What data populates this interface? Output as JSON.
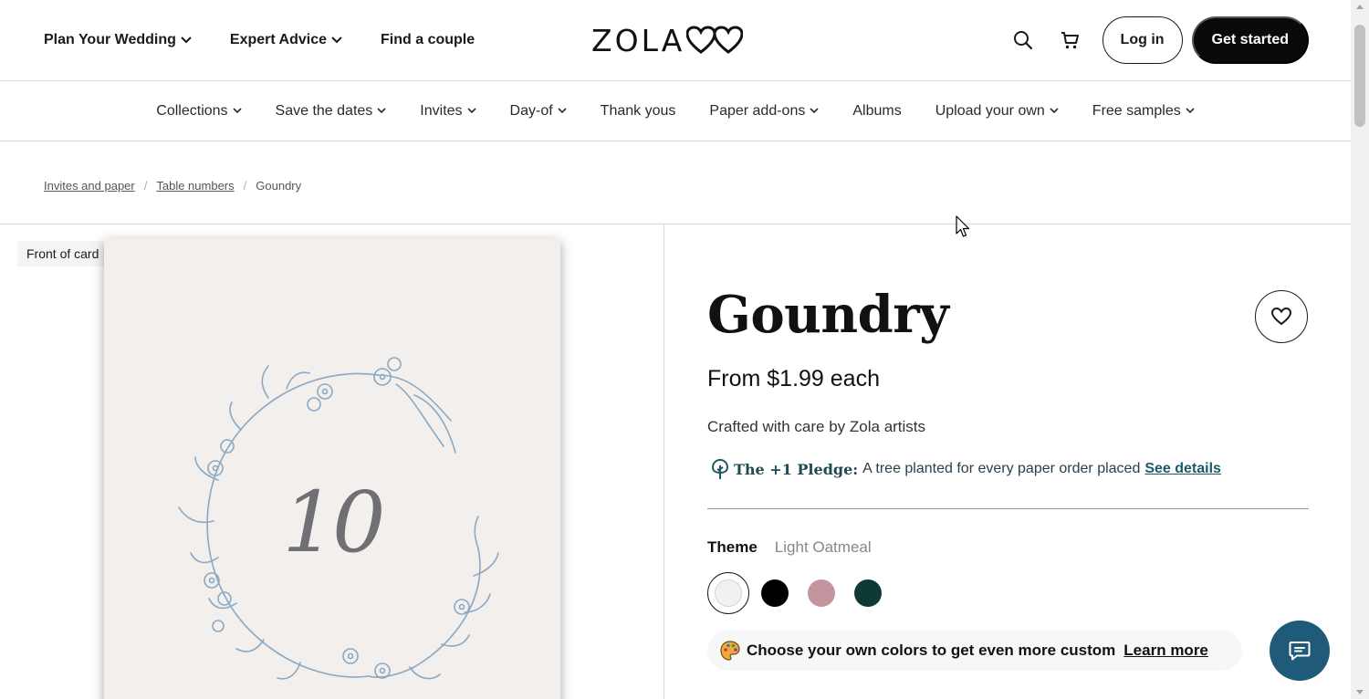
{
  "header": {
    "primary_nav": [
      {
        "label": "Plan Your Wedding",
        "has_dropdown": true
      },
      {
        "label": "Expert Advice",
        "has_dropdown": true
      },
      {
        "label": "Find a couple",
        "has_dropdown": false
      }
    ],
    "logo_text": "ZOLA",
    "login_label": "Log in",
    "get_started_label": "Get started",
    "icons": [
      "search-icon",
      "cart-icon",
      "double-heart-logo-icon"
    ]
  },
  "secondary_nav": [
    {
      "label": "Collections",
      "has_dropdown": true
    },
    {
      "label": "Save the dates",
      "has_dropdown": true
    },
    {
      "label": "Invites",
      "has_dropdown": true
    },
    {
      "label": "Day-of",
      "has_dropdown": true
    },
    {
      "label": "Thank yous",
      "has_dropdown": false
    },
    {
      "label": "Paper add-ons",
      "has_dropdown": true
    },
    {
      "label": "Albums",
      "has_dropdown": false
    },
    {
      "label": "Upload your own",
      "has_dropdown": true
    },
    {
      "label": "Free samples",
      "has_dropdown": true
    }
  ],
  "breadcrumb": {
    "items": [
      "Invites and paper",
      "Table numbers"
    ],
    "current": "Goundry"
  },
  "preview": {
    "label": "Front of card",
    "card_number": "10",
    "card_background": "#f3efec",
    "wreath_color": "#8aa9c4"
  },
  "product": {
    "title": "Goundry",
    "price": "From $1.99 each",
    "crafted": "Crafted with care by Zola artists",
    "pledge_title": "The +1 Pledge:",
    "pledge_text": "A tree planted for every paper order placed",
    "pledge_link": "See details",
    "theme_label": "Theme",
    "theme_value": "Light Oatmeal",
    "swatches": [
      {
        "name": "Light Oatmeal",
        "color": "#f3f1ef",
        "selected": true
      },
      {
        "name": "Black",
        "color": "#000000",
        "selected": false
      },
      {
        "name": "Mauve",
        "color": "#c3959f",
        "selected": false
      },
      {
        "name": "Forest",
        "color": "#0e3a36",
        "selected": false
      }
    ],
    "custom_text": "Choose your own colors to get even more custom",
    "custom_link": "Learn more"
  },
  "colors": {
    "accent_dark": "#0a0a0a",
    "chat_button": "#1f5a78",
    "pledge_teal": "#1e5a66"
  }
}
